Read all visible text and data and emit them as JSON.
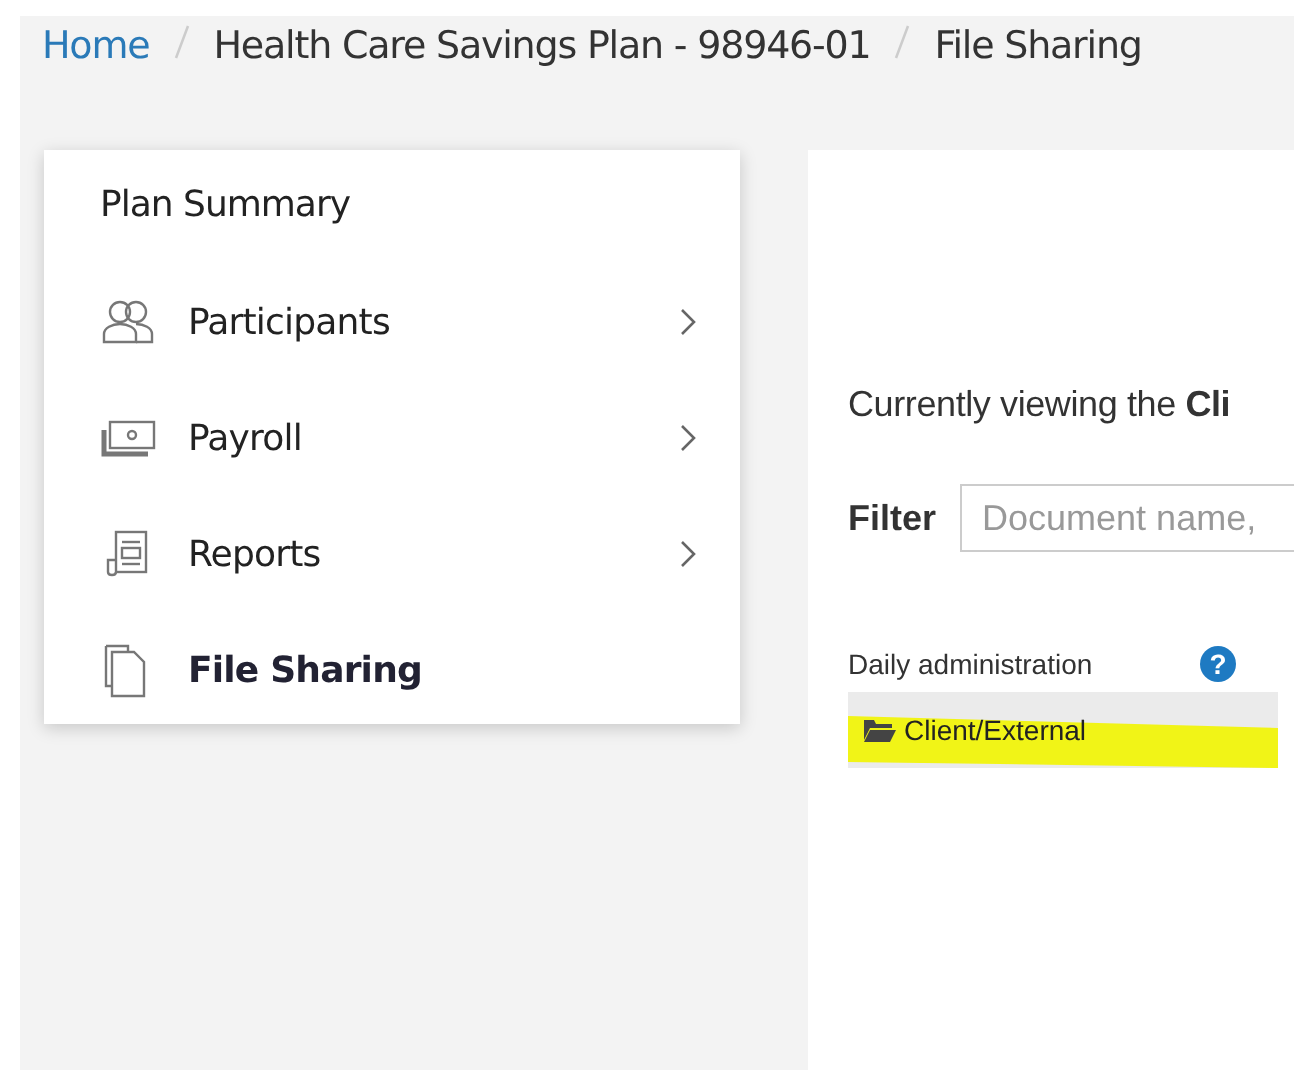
{
  "breadcrumb": [
    {
      "label": "Home",
      "link": true
    },
    {
      "label": "Health Care Savings Plan - 98946-01",
      "link": false
    },
    {
      "label": "File Sharing",
      "link": false
    }
  ],
  "sidebar": {
    "title": "Plan Summary",
    "items": [
      {
        "label": "Participants",
        "expandable": true,
        "selected": false
      },
      {
        "label": "Payroll",
        "expandable": true,
        "selected": false
      },
      {
        "label": "Reports",
        "expandable": true,
        "selected": false
      },
      {
        "label": "File Sharing",
        "expandable": false,
        "selected": true
      }
    ]
  },
  "content": {
    "viewing_text": "Currently viewing the **Cli**",
    "filter": {
      "label": "Filter",
      "placeholder": "Document name,"
    },
    "section": {
      "title": "Daily administration",
      "help": "?"
    },
    "folders": [
      {
        "label": "Client/External",
        "selected": true,
        "highlighted": true
      }
    ]
  }
}
